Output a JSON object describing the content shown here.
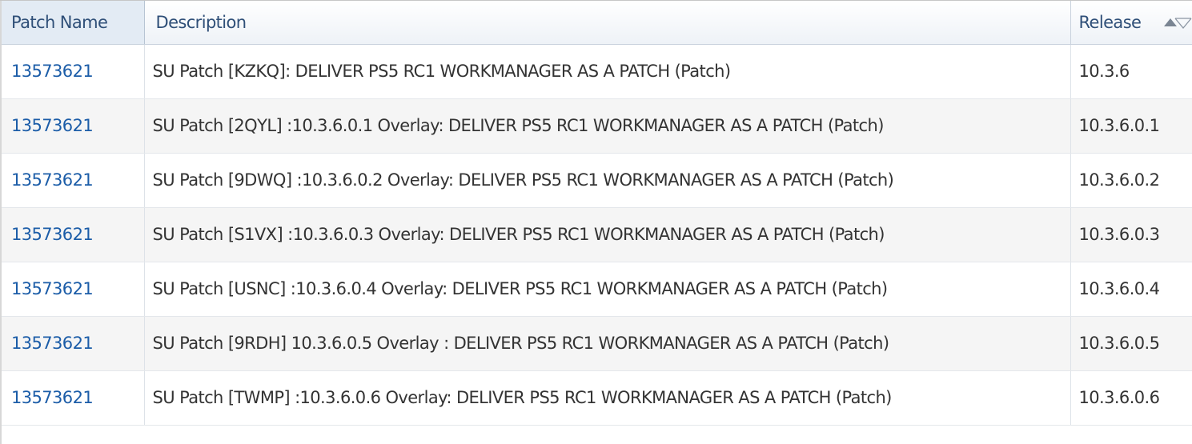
{
  "columns": {
    "patch_name": "Patch Name",
    "description": "Description",
    "release": "Release"
  },
  "rows": [
    {
      "patch_name": "13573621",
      "description": "SU Patch [KZKQ]: DELIVER PS5 RC1 WORKMANAGER AS A PATCH (Patch)",
      "release": "10.3.6"
    },
    {
      "patch_name": "13573621",
      "description": "SU Patch [2QYL] :10.3.6.0.1 Overlay: DELIVER PS5 RC1 WORKMANAGER AS A PATCH (Patch)",
      "release": "10.3.6.0.1"
    },
    {
      "patch_name": "13573621",
      "description": "SU Patch [9DWQ] :10.3.6.0.2 Overlay: DELIVER PS5 RC1 WORKMANAGER AS A PATCH (Patch)",
      "release": "10.3.6.0.2"
    },
    {
      "patch_name": "13573621",
      "description": "SU Patch [S1VX] :10.3.6.0.3 Overlay: DELIVER PS5 RC1 WORKMANAGER AS A PATCH (Patch)",
      "release": "10.3.6.0.3"
    },
    {
      "patch_name": "13573621",
      "description": "SU Patch [USNC] :10.3.6.0.4 Overlay: DELIVER PS5 RC1 WORKMANAGER AS A PATCH (Patch)",
      "release": "10.3.6.0.4"
    },
    {
      "patch_name": "13573621",
      "description": "SU Patch [9RDH] 10.3.6.0.5 Overlay : DELIVER PS5 RC1 WORKMANAGER AS A PATCH (Patch)",
      "release": "10.3.6.0.5"
    },
    {
      "patch_name": "13573621",
      "description": "SU Patch [TWMP] :10.3.6.0.6 Overlay: DELIVER PS5 RC1 WORKMANAGER AS A PATCH (Patch)",
      "release": "10.3.6.0.6"
    }
  ],
  "icons": {
    "sort_ascending": "sort-ascending-icon",
    "sort_descending": "sort-descending-icon"
  },
  "colors": {
    "link": "#1c5da8",
    "header_text": "#2f4f78",
    "stripe": "#f5f5f5"
  }
}
